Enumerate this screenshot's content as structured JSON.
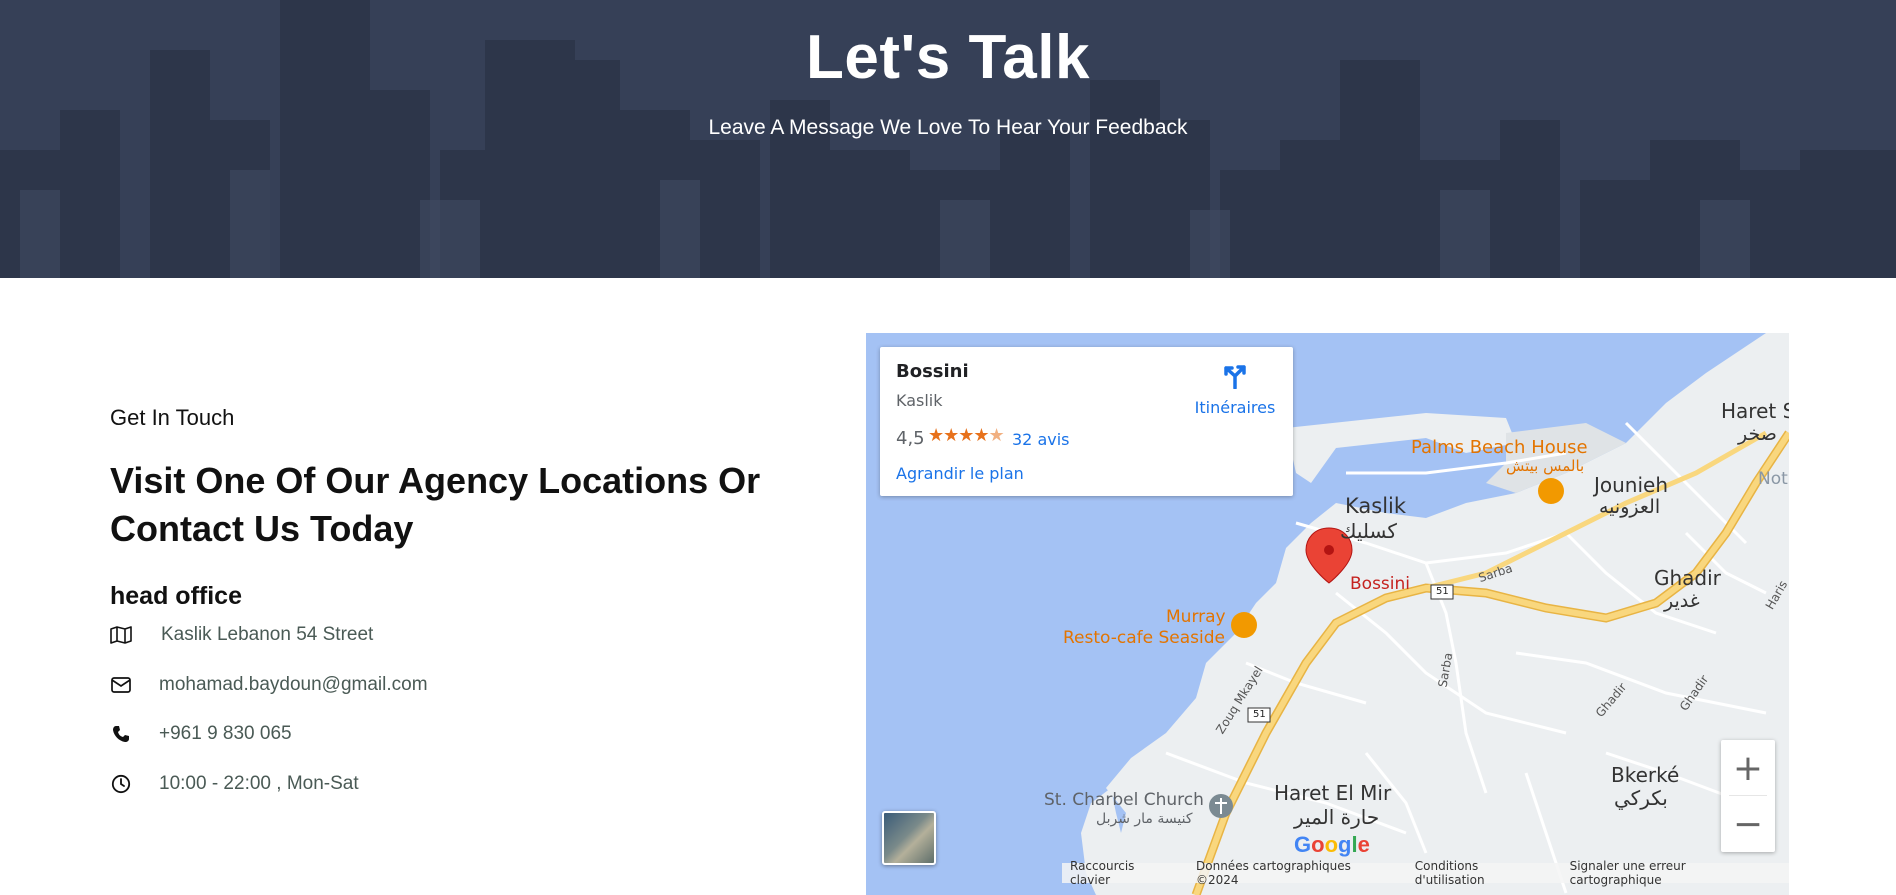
{
  "hero": {
    "title": "Let's Talk",
    "subtitle": "Leave A Message We Love To Hear Your Feedback"
  },
  "contact": {
    "kicker": "Get In Touch",
    "headline": "Visit One Of Our Agency Locations Or Contact Us Today",
    "office_title": "head office",
    "items": [
      {
        "icon": "map-icon",
        "text": "Kaslik Lebanon 54 Street"
      },
      {
        "icon": "envelope-icon",
        "text": "mohamad.baydoun@gmail.com"
      },
      {
        "icon": "phone-icon",
        "text": "+961 9 830 065"
      },
      {
        "icon": "clock-icon",
        "text": "10:00 - 22:00 , Mon-Sat"
      }
    ]
  },
  "map": {
    "card": {
      "name": "Bossini",
      "location": "Kaslik",
      "rating": "4,5",
      "stars": 4.5,
      "reviews": "32 avis",
      "enlarge": "Agrandir le plan",
      "directions": "Itinéraires"
    },
    "labels": {
      "haret_s": "Haret S",
      "haret_s_ar": "صخر",
      "palms_beach": "Palms Beach House",
      "palms_beach_ar": "بالمس بيتش",
      "jounieh": "Jounieh",
      "jounieh_ar": "العزونيه",
      "not": "Not",
      "kaslik": "Kaslik",
      "kaslik_ar": "كسليك",
      "bossini": "Bossini",
      "sarba": "Sarba",
      "sarba2": "Sarba",
      "ghadir": "Ghadir",
      "ghadir_ar": "غدير",
      "ghadir_road": "Ghadir",
      "ghadir_road2": "Ghadir",
      "haris": "Haris",
      "route51a": "51",
      "route51b": "51",
      "zouq": "Zouq Mkayel",
      "murray": "Murray",
      "murray2": "Resto-cafe Seaside",
      "st_charbel": "St. Charbel Church",
      "st_charbel_ar": "كنيسة مار شربل",
      "haret_el_mir": "Haret El Mir",
      "haret_el_mir_ar": "حارة المير",
      "bkerke": "Bkerké",
      "bkerke_ar": "بكركي"
    },
    "zoom_in": "+",
    "zoom_out": "−",
    "google": "Google",
    "attribution": [
      "Raccourcis clavier",
      "Données cartographiques ©2024",
      "Conditions d'utilisation",
      "Signaler une erreur cartographique"
    ],
    "colors": {
      "water": "#a4c2f4",
      "land": "#eceff1",
      "highway": "#f9c74f",
      "marker": "#ea4335",
      "poi_food": "#f29900",
      "link": "#1a73e8"
    }
  }
}
